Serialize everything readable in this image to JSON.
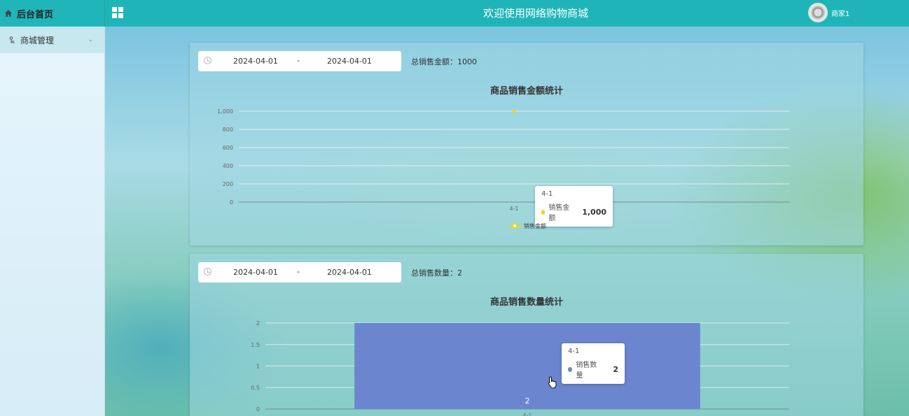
{
  "header": {
    "brand": "后台首页",
    "title": "欢迎使用网络购物商城",
    "user": "商家1"
  },
  "sidebar": {
    "items": [
      {
        "label": "商城管理"
      }
    ]
  },
  "panels": [
    {
      "date_start": "2024-04-01",
      "date_sep": "-",
      "date_end": "2024-04-01",
      "total_text": "总销售金额：1000",
      "tooltip": {
        "title": "4-1",
        "series": "销售金额",
        "value": "1,000"
      },
      "legend": "销售金额"
    },
    {
      "date_start": "2024-04-01",
      "date_sep": "-",
      "date_end": "2024-04-01",
      "total_text": "总销售数量：2",
      "tooltip": {
        "title": "4-1",
        "series": "销售数量",
        "value": "2"
      }
    }
  ],
  "colors": {
    "header_bg": "#1fb5b8",
    "line_series": "#f5d40a",
    "bar_series": "#6b86cf"
  },
  "chart_data": [
    {
      "type": "line",
      "title": "商品销售金额统计",
      "categories": [
        "4-1"
      ],
      "series": [
        {
          "name": "销售金额",
          "values": [
            1000
          ]
        }
      ],
      "ylim": [
        0,
        1000
      ],
      "yticks": [
        "0",
        "200",
        "400",
        "600",
        "800",
        "1,000"
      ],
      "legend": "bottom",
      "grid": true
    },
    {
      "type": "bar",
      "title": "商品销售数量统计",
      "categories": [
        "4-1"
      ],
      "series": [
        {
          "name": "销售数量",
          "values": [
            2
          ]
        }
      ],
      "ylim": [
        0,
        2
      ],
      "yticks": [
        "0",
        "0.5",
        "1",
        "1.5",
        "2"
      ],
      "data_labels": [
        "2"
      ],
      "grid": true
    }
  ]
}
